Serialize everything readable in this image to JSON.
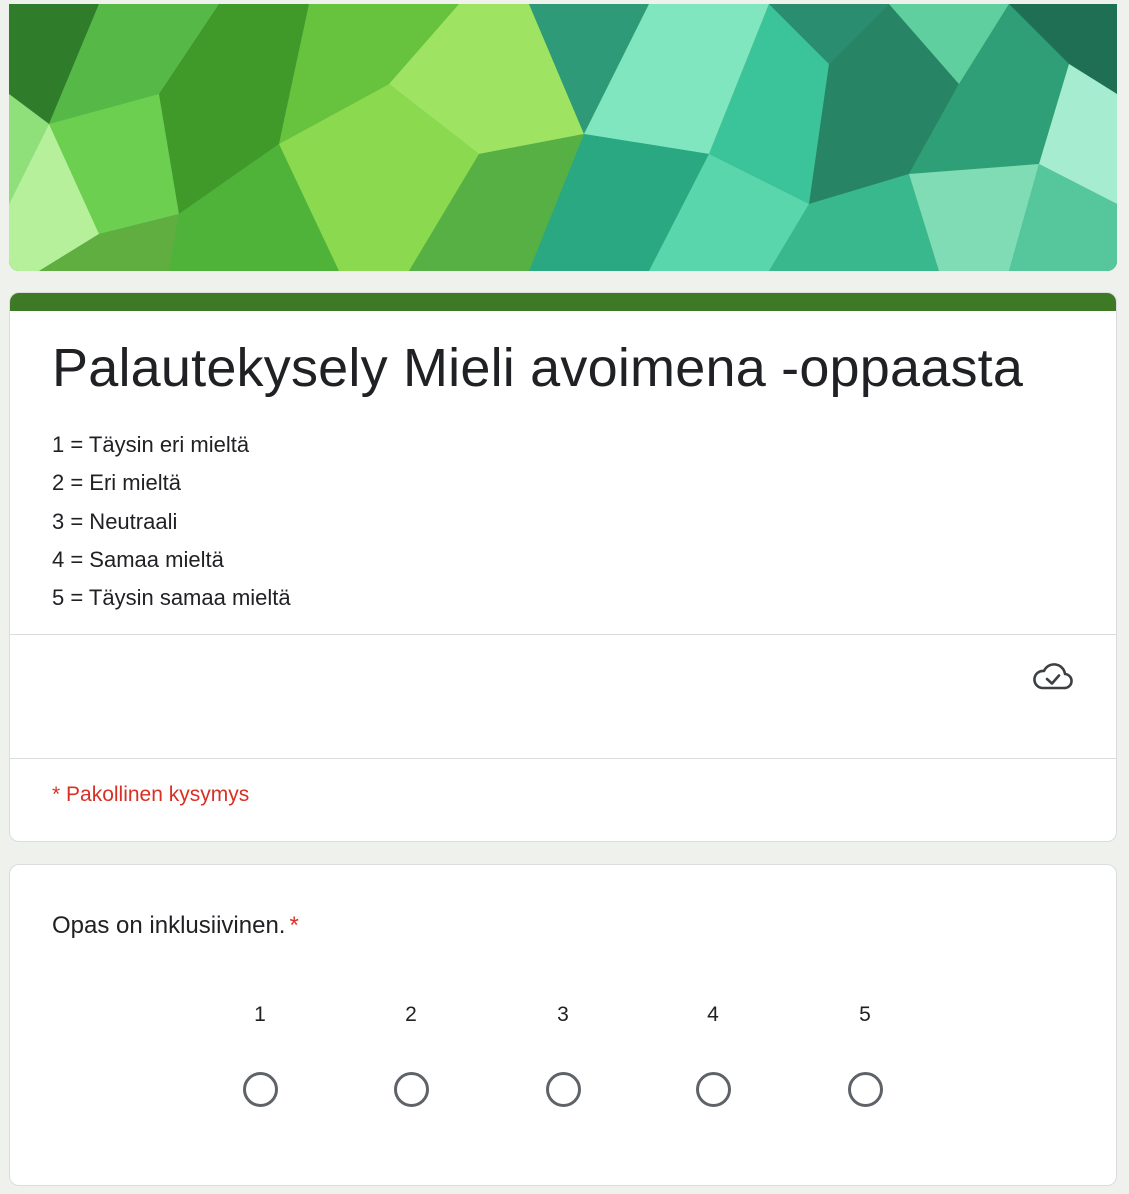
{
  "form": {
    "title": "Palautekysely Mieli avoimena -oppaasta",
    "description": [
      "1 = Täysin eri mieltä",
      "2 = Eri mieltä",
      "3 = Neutraali",
      "4 = Samaa mieltä",
      "5 = Täysin samaa mieltä"
    ],
    "required_note": "* Pakollinen kysymys",
    "save_status_icon": "cloud-check-icon",
    "accent_color": "#3e7a26",
    "required_color": "#d93025"
  },
  "question": {
    "title": "Opas on inklusiivinen.",
    "required_marker": "*",
    "scale": [
      {
        "label": "1",
        "selected": false
      },
      {
        "label": "2",
        "selected": false
      },
      {
        "label": "3",
        "selected": false
      },
      {
        "label": "4",
        "selected": false
      },
      {
        "label": "5",
        "selected": false
      }
    ]
  }
}
